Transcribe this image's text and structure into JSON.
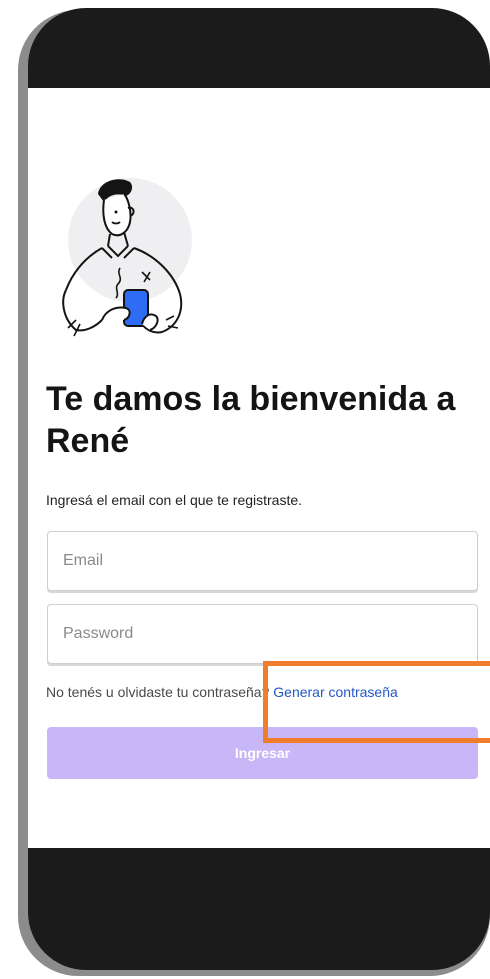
{
  "login": {
    "title": "Te damos la bienvenida a René",
    "subtitle": "Ingresá el email con el que te registraste.",
    "email_placeholder": "Email",
    "password_placeholder": "Password",
    "help_text": "No tenés u olvidaste tu contraseña?",
    "help_link": "Generar contraseña",
    "submit_label": "Ingresar"
  },
  "colors": {
    "accent_link": "#2557c7",
    "button_bg": "#c7b7f6",
    "phone_blue": "#2f6cf6",
    "annotation": "#ef7d2b"
  },
  "icons": {
    "illustration": "man-holding-phone-illustration"
  }
}
